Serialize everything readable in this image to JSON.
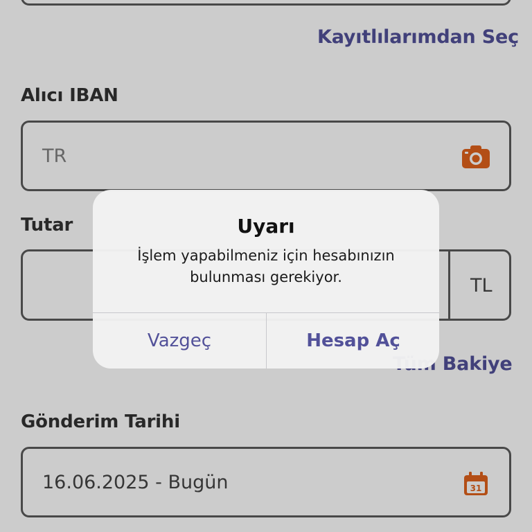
{
  "form": {
    "choose_saved_link": "Kayıtlılarımdan Seç",
    "iban_label": "Alıcı IBAN",
    "iban_value": "TR",
    "amount_label": "Tutar",
    "amount_value": "",
    "currency": "TL",
    "full_balance_link": "Tüm Bakiye",
    "date_label": "Gönderim Tarihi",
    "date_value": "16.06.2025 - Bugün",
    "calendar_day": "31"
  },
  "alert": {
    "title": "Uyarı",
    "message": "İşlem yapabilmeniz için hesabınızın bulunması gerekiyor.",
    "cancel_button": "Vazgeç",
    "confirm_button": "Hesap Aç"
  },
  "colors": {
    "accent": "#525199",
    "icon_orange": "#e0621c",
    "overlay": "rgba(0,0,0,0.2)"
  },
  "icons": {
    "camera": "camera-icon",
    "calendar": "calendar-icon"
  }
}
